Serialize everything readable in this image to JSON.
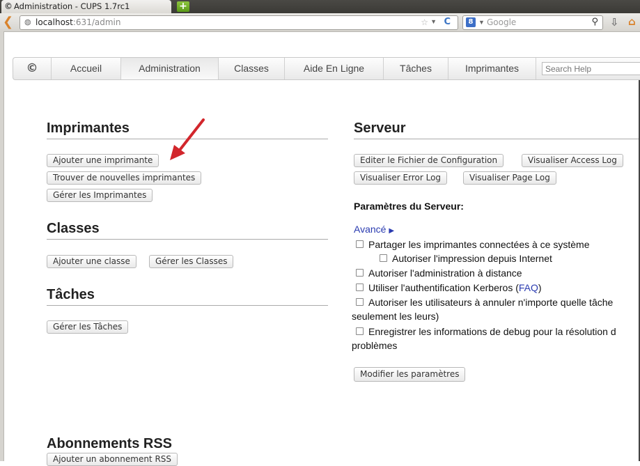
{
  "browser": {
    "tab_title": "Administration - CUPS 1.7rc1",
    "url_host": "localhost",
    "url_rest": ":631/admin",
    "search_engine_placeholder": "Google"
  },
  "cups_nav": {
    "tabs": [
      "Accueil",
      "Administration",
      "Classes",
      "Aide En Ligne",
      "Tâches",
      "Imprimantes"
    ],
    "active_tab": "Administration",
    "help_search_placeholder": "Search Help"
  },
  "printers": {
    "heading": "Imprimantes",
    "add_printer": "Ajouter une imprimante",
    "find_new_printers": "Trouver de nouvelles imprimantes",
    "manage_printers": "Gérer les Imprimantes"
  },
  "classes": {
    "heading": "Classes",
    "add_class": "Ajouter une classe",
    "manage_classes": "Gérer les Classes"
  },
  "jobs": {
    "heading": "Tâches",
    "manage_jobs": "Gérer les Tâches"
  },
  "rss": {
    "heading": "Abonnements RSS",
    "add_subscription": "Ajouter un abonnement RSS"
  },
  "server": {
    "heading": "Serveur",
    "edit_config": "Editer le Fichier de Configuration",
    "view_access_log": "Visualiser Access Log",
    "view_error_log": "Visualiser Error Log",
    "view_page_log": "Visualiser Page Log",
    "settings_label": "Paramètres du Serveur:",
    "advanced": "Avancé",
    "opt_share": "Partager les imprimantes connectées à ce système",
    "opt_internet": "Autoriser l'impression depuis Internet",
    "opt_remote_admin": "Autoriser l'administration à distance",
    "opt_kerberos": "Utiliser l'authentification Kerberos (",
    "opt_kerberos_link": "FAQ",
    "opt_kerberos_end": ")",
    "opt_cancel_line1": "Autoriser les utilisateurs à annuler n'importe quelle tâche",
    "opt_cancel_line2": "seulement les leurs)",
    "opt_debug_line1": "Enregistrer les informations de debug pour la résolution d",
    "opt_debug_line2": "problèmes",
    "modify_settings": "Modifier les paramètres"
  },
  "colors": {
    "link": "#2a3bb0",
    "annotation_arrow": "#d2262c"
  }
}
